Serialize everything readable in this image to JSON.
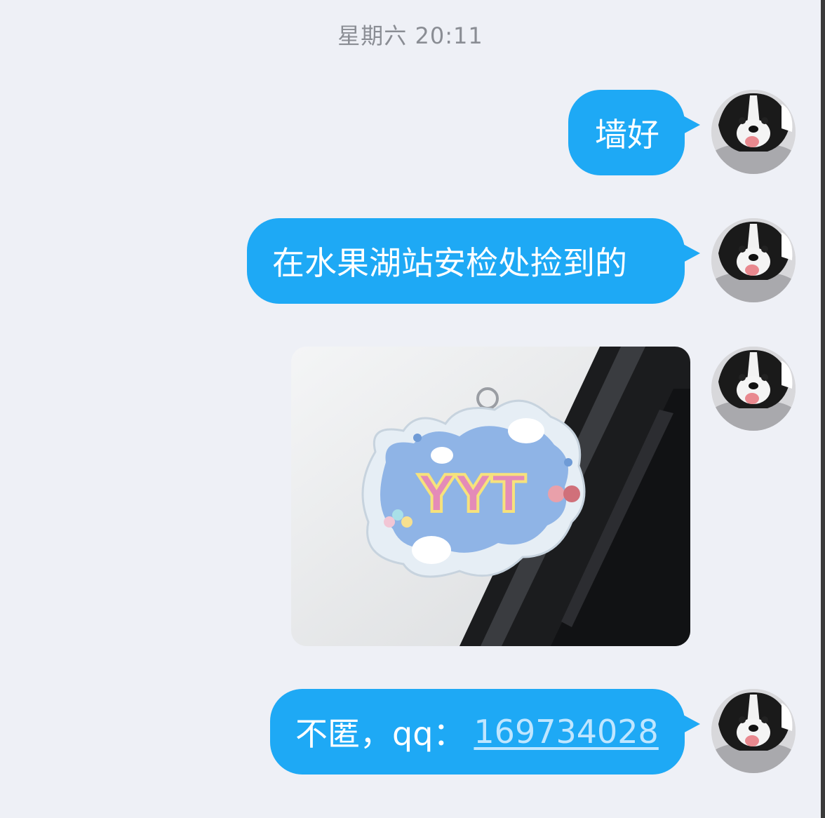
{
  "chat": {
    "timestamp": "星期六 20:11",
    "messages": [
      {
        "type": "text",
        "text": "墙好"
      },
      {
        "type": "text",
        "text": "在水果湖站安检处捡到的"
      },
      {
        "type": "image",
        "keychain_text": "YYT"
      },
      {
        "type": "text",
        "prefix": "不匿，qq：",
        "link": "169734028"
      }
    ]
  },
  "icons": {
    "avatar": "dog-avatar-icon"
  },
  "colors": {
    "background": "#eef0f6",
    "bubble": "#1ea9f5",
    "bubble_text": "#ffffff",
    "link": "#bfe6ff",
    "timestamp": "#8a8d94"
  }
}
